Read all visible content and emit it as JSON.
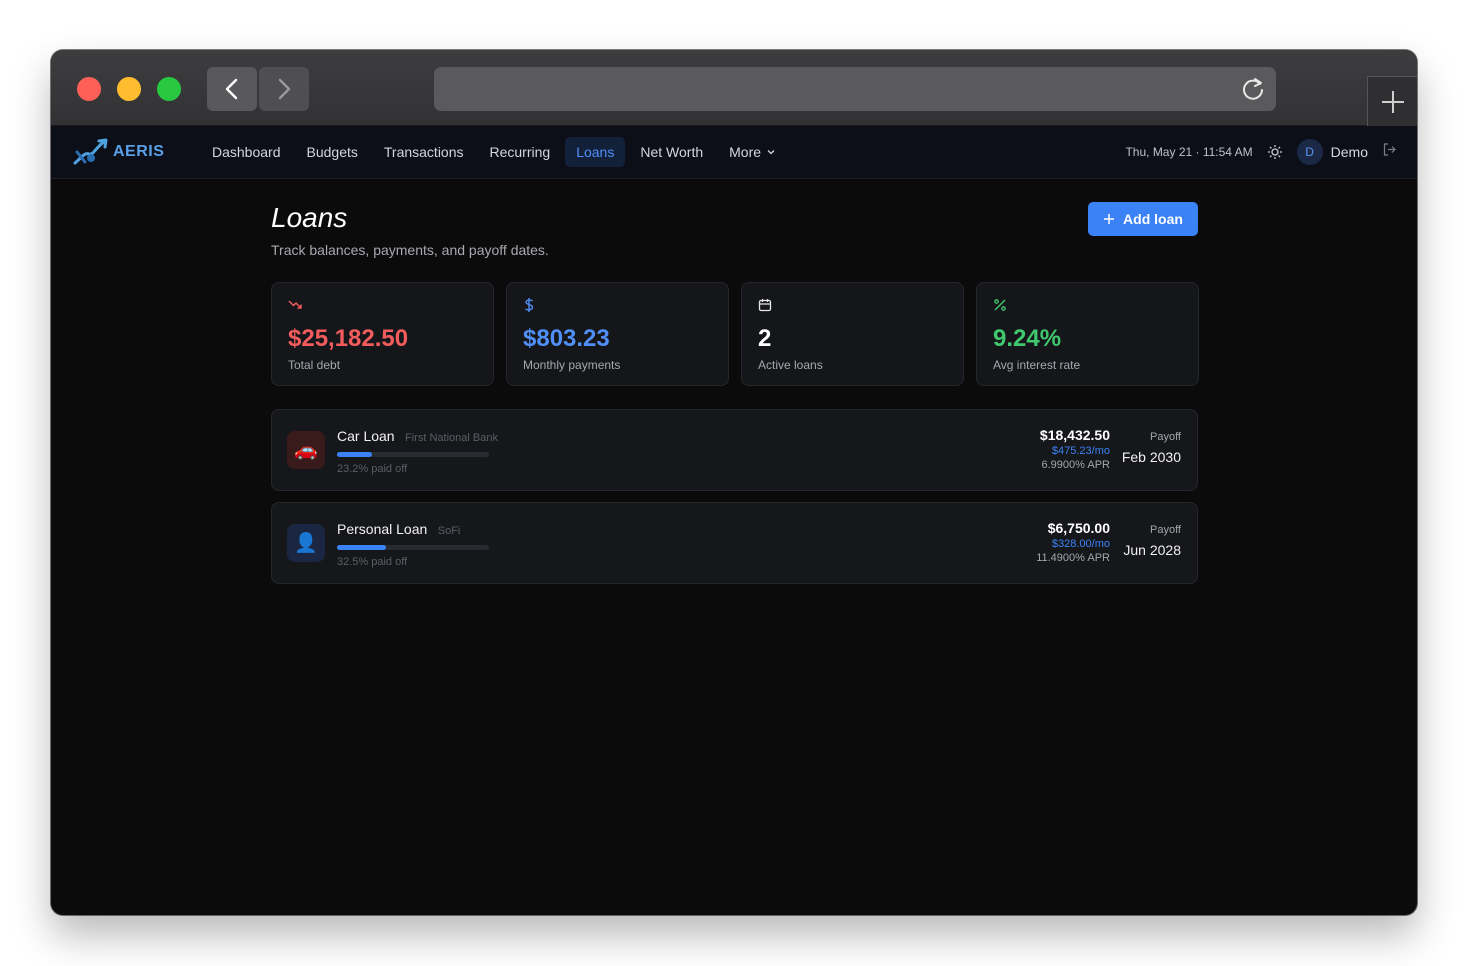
{
  "app": {
    "brand": "AERIS"
  },
  "nav": {
    "items": [
      {
        "label": "Dashboard",
        "active": false
      },
      {
        "label": "Budgets",
        "active": false
      },
      {
        "label": "Transactions",
        "active": false
      },
      {
        "label": "Recurring",
        "active": false
      },
      {
        "label": "Loans",
        "active": true
      },
      {
        "label": "Net Worth",
        "active": false
      },
      {
        "label": "More",
        "active": false
      }
    ],
    "datetime": "Thu, May 21 · 11:54 AM",
    "avatar_initial": "D",
    "username": "Demo"
  },
  "page": {
    "title": "Loans",
    "subtitle": "Track balances, payments, and payoff dates.",
    "add_button": "Add loan"
  },
  "stats": [
    {
      "icon": "trending-down-icon",
      "value": "$25,182.50",
      "label": "Total debt",
      "color": "#f25c5c"
    },
    {
      "icon": "dollar-icon",
      "value": "$803.23",
      "label": "Monthly payments",
      "color": "#4f8ff7"
    },
    {
      "icon": "calendar-icon",
      "value": "2",
      "label": "Active loans",
      "color": "#ffffff"
    },
    {
      "icon": "percent-icon",
      "value": "9.24%",
      "label": "Avg interest rate",
      "color": "#3fc86e"
    }
  ],
  "loans": [
    {
      "icon": "car-icon",
      "name": "Car Loan",
      "lender": "First National Bank",
      "progress_pct": 23.2,
      "paid_text": "23.2% paid off",
      "balance": "$18,432.50",
      "monthly": "$475.23/mo",
      "apr": "6.9900% APR",
      "payoff_label": "Payoff",
      "payoff_date": "Feb 2030"
    },
    {
      "icon": "person-icon",
      "name": "Personal Loan",
      "lender": "SoFi",
      "progress_pct": 32.5,
      "paid_text": "32.5% paid off",
      "balance": "$6,750.00",
      "monthly": "$328.00/mo",
      "apr": "11.4900% APR",
      "payoff_label": "Payoff",
      "payoff_date": "Jun 2028"
    }
  ]
}
